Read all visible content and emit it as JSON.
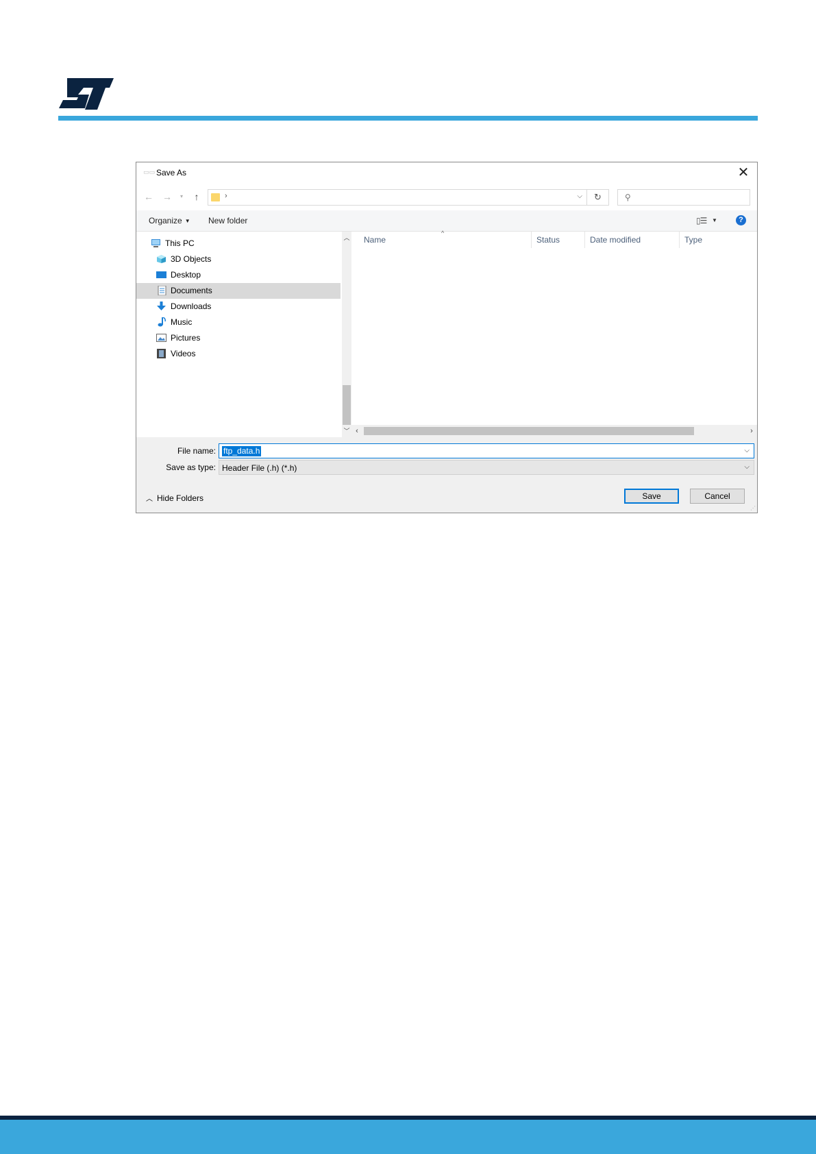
{
  "dialog": {
    "title": "Save As",
    "address_separator": "›",
    "toolbar": {
      "organize": "Organize",
      "new_folder": "New folder",
      "help": "?"
    },
    "tree": [
      {
        "label": "This PC",
        "icon": "computer-icon"
      },
      {
        "label": "3D Objects",
        "icon": "cube-icon"
      },
      {
        "label": "Desktop",
        "icon": "desktop-icon"
      },
      {
        "label": "Documents",
        "icon": "documents-icon",
        "selected": true
      },
      {
        "label": "Downloads",
        "icon": "download-arrow-icon"
      },
      {
        "label": "Music",
        "icon": "music-note-icon"
      },
      {
        "label": "Pictures",
        "icon": "pictures-icon"
      },
      {
        "label": "Videos",
        "icon": "film-icon"
      }
    ],
    "columns": [
      "Name",
      "Status",
      "Date modified",
      "Type"
    ],
    "file_name_label": "File name:",
    "file_name_value": "ftp_data.h",
    "save_as_type_label": "Save as type:",
    "save_as_type_value": "Header File (.h)  (*.h)",
    "hide_folders": "Hide Folders",
    "save_button": "Save",
    "cancel_button": "Cancel"
  },
  "colors": {
    "accent": "#0078d7",
    "brand_light": "#3aa7dc",
    "brand_dark": "#0b2340"
  }
}
